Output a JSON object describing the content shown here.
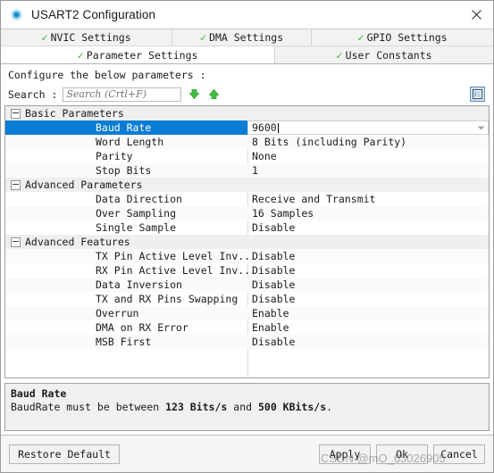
{
  "window": {
    "title": "USART2 Configuration",
    "icon": "config-module-icon",
    "close_label": "✕"
  },
  "tabs": {
    "row1": [
      {
        "label": "NVIC Settings",
        "checked": true,
        "active": false
      },
      {
        "label": "DMA Settings",
        "checked": true,
        "active": false
      },
      {
        "label": "GPIO Settings",
        "checked": true,
        "active": false
      }
    ],
    "row2": [
      {
        "label": "Parameter Settings",
        "checked": true,
        "active": true
      },
      {
        "label": "User Constants",
        "checked": true,
        "active": false
      }
    ],
    "check_glyph": "✓"
  },
  "toolbar": {
    "configure_line": "Configure the below parameters :",
    "search_label": "Search :",
    "search_value": "",
    "search_placeholder": "Search (Crtl+F)",
    "find_next_title": "find-next",
    "find_prev_title": "find-previous",
    "grid_toggle_title": "toggle-grid-view"
  },
  "tree": {
    "groups": [
      {
        "label": "Basic Parameters",
        "expanded": true,
        "rows": [
          {
            "name": "Baud Rate",
            "value": "9600",
            "selected": true,
            "editing": true,
            "dropdown": true
          },
          {
            "name": "Word Length",
            "value": "8 Bits (including Parity)",
            "selected": false,
            "editing": false,
            "dropdown": false
          },
          {
            "name": "Parity",
            "value": "None",
            "selected": false,
            "editing": false,
            "dropdown": false
          },
          {
            "name": "Stop Bits",
            "value": "1",
            "selected": false,
            "editing": false,
            "dropdown": false
          }
        ]
      },
      {
        "label": "Advanced Parameters",
        "expanded": true,
        "rows": [
          {
            "name": "Data Direction",
            "value": "Receive and Transmit",
            "selected": false,
            "editing": false,
            "dropdown": false
          },
          {
            "name": "Over Sampling",
            "value": "16 Samples",
            "selected": false,
            "editing": false,
            "dropdown": false
          },
          {
            "name": "Single Sample",
            "value": "Disable",
            "selected": false,
            "editing": false,
            "dropdown": false
          }
        ]
      },
      {
        "label": "Advanced Features",
        "expanded": true,
        "rows": [
          {
            "name": "TX Pin Active Level Inv...",
            "value": "Disable",
            "selected": false,
            "editing": false,
            "dropdown": false
          },
          {
            "name": "RX Pin Active Level Inv...",
            "value": "Disable",
            "selected": false,
            "editing": false,
            "dropdown": false
          },
          {
            "name": "Data Inversion",
            "value": "Disable",
            "selected": false,
            "editing": false,
            "dropdown": false
          },
          {
            "name": "TX and RX Pins Swapping",
            "value": "Disable",
            "selected": false,
            "editing": false,
            "dropdown": false
          },
          {
            "name": "Overrun",
            "value": "Enable",
            "selected": false,
            "editing": false,
            "dropdown": false
          },
          {
            "name": "DMA on RX Error",
            "value": "Enable",
            "selected": false,
            "editing": false,
            "dropdown": false
          },
          {
            "name": "MSB First",
            "value": "Disable",
            "selected": false,
            "editing": false,
            "dropdown": false
          }
        ]
      }
    ]
  },
  "description": {
    "title": "Baud Rate",
    "text_prefix": "BaudRate must be between ",
    "bold_min": "123 Bits/s",
    "text_middle": " and ",
    "bold_max": "500 KBits/s",
    "text_suffix": "."
  },
  "footer": {
    "restore_label": "Restore Default",
    "apply_label": "Apply",
    "ok_label": "Ok",
    "cancel_label": "Cancel"
  },
  "watermark": {
    "text": "CSDN @mO_65026905"
  },
  "colors": {
    "selection_blue": "#0a7cd4",
    "check_green": "#35bb35",
    "arrow_green": "#3fc23f",
    "title_icon_blue": "#29a3dd",
    "group_bg": "#efefef"
  }
}
